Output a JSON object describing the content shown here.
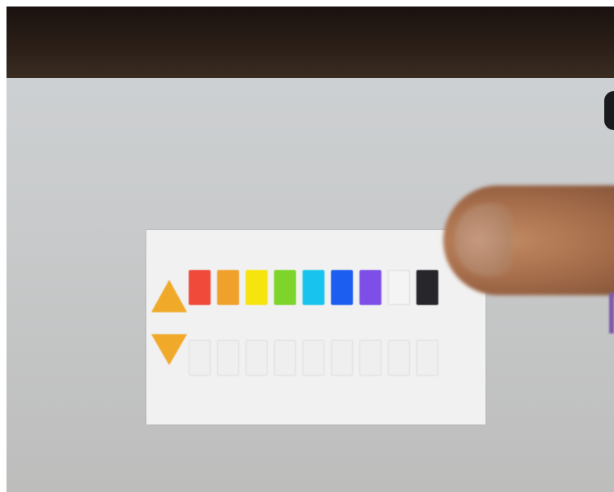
{
  "colors": {
    "arrow": "#f0a928",
    "panel_background": "#f1f1f1",
    "empty_slot": "#efefef"
  },
  "palette": {
    "swatches": [
      {
        "name": "red",
        "color": "#ef4a3a"
      },
      {
        "name": "orange",
        "color": "#f0a12c"
      },
      {
        "name": "yellow",
        "color": "#f6e40e"
      },
      {
        "name": "green",
        "color": "#7ed42a"
      },
      {
        "name": "cyan",
        "color": "#18c4ee"
      },
      {
        "name": "blue",
        "color": "#1b5ef0"
      },
      {
        "name": "purple",
        "color": "#7d4ee8"
      },
      {
        "name": "white",
        "color": "#f4f4f4"
      },
      {
        "name": "black",
        "color": "#27262b"
      }
    ]
  },
  "slots": {
    "count": 9
  },
  "icons": {
    "up": "triangle-up-icon",
    "down": "triangle-down-icon"
  }
}
